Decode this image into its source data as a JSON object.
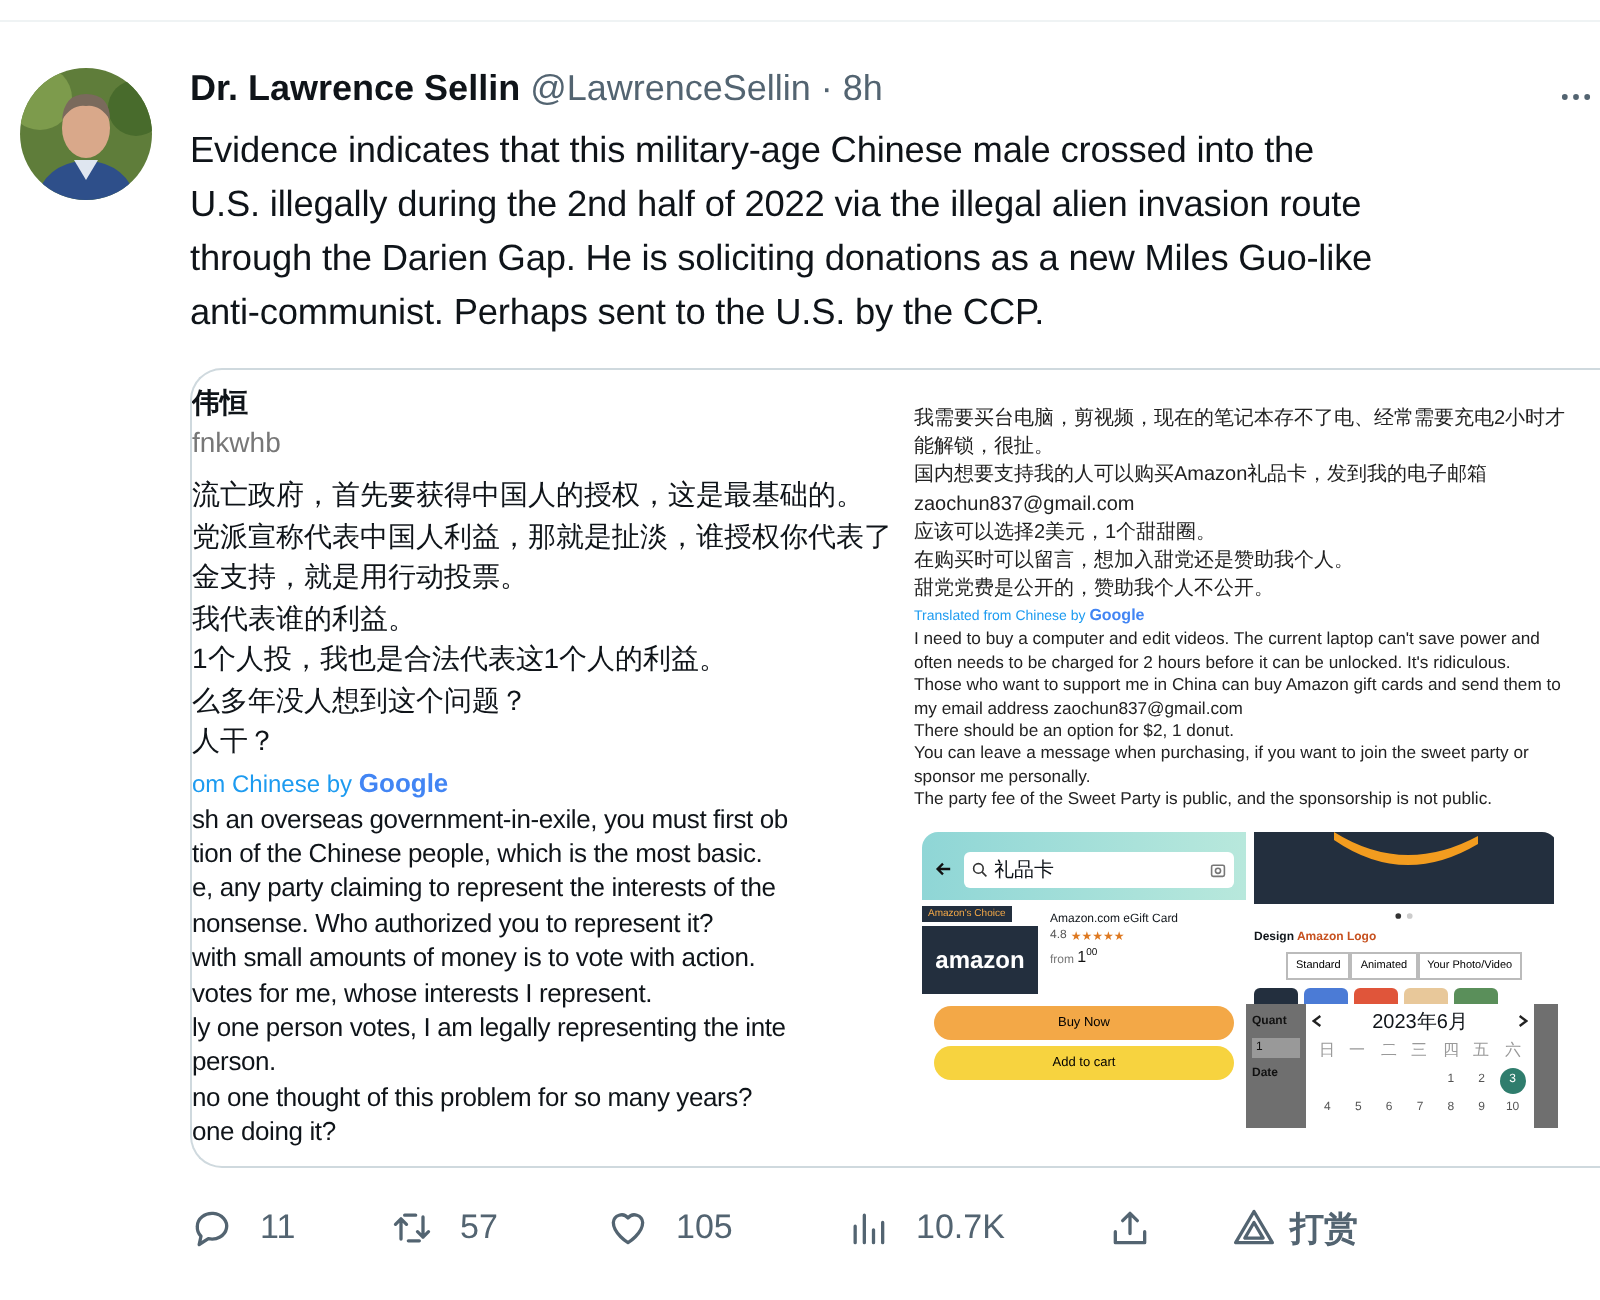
{
  "tweet": {
    "author": "Dr. Lawrence Sellin",
    "handle": "@LawrenceSellin",
    "separator": "·",
    "time": "8h",
    "text_lines": [
      "Evidence indicates that this military-age Chinese male crossed into the",
      "U.S. illegally during the 2nd half of 2022 via the illegal alien invasion route",
      "through the Darien Gap. He is soliciting donations as a new Miles Guo-like",
      "anti-communist. Perhaps sent to the U.S. by the CCP."
    ]
  },
  "left_image": {
    "name": "伟恒",
    "handle": "fnkwhb",
    "original_lines": [
      "流亡政府，首先要获得中国人的授权，这是最基础的。",
      "党派宣称代表中国人利益，那就是扯淡，谁授权你代表了",
      "金支持，就是用行动投票。",
      "我代表谁的利益。",
      "1个人投，我也是合法代表这1个人的利益。",
      "么多年没人想到这个问题？",
      "人干？"
    ],
    "translated_prefix": "om Chinese by",
    "translated_brand": "Google",
    "translation_lines": [
      "sh an overseas government-in-exile, you must first ob",
      "tion of the Chinese people, which is the most basic.",
      "e, any party claiming to represent the interests of the",
      "nonsense. Who authorized you to represent it?",
      "with small amounts of money is to vote with action.",
      "votes for me, whose interests I represent.",
      "ly one person votes, I am legally representing the inte",
      "person.",
      "no one thought of this problem for so many years?",
      "one doing it?"
    ]
  },
  "right_image": {
    "original_lines": [
      "我需要买台电脑，剪视频，现在的笔记本存不了电、经常需要充电2小时才能解锁，很扯。",
      "国内想要支持我的人可以购买Amazon礼品卡，发到我的电子邮箱 zaochun837@gmail.com",
      "应该可以选择2美元，1个甜甜圈。",
      "在购买时可以留言，想加入甜党还是赞助我个人。",
      "甜党党费是公开的，赞助我个人不公开。"
    ],
    "translated_prefix": "Translated from Chinese by",
    "translated_brand": "Google",
    "translation_lines": [
      "I need to buy a computer and edit videos. The current laptop can't save power and often needs to be charged for 2 hours before it can be unlocked. It's ridiculous.",
      "Those who want to support me in China can buy Amazon gift cards and send them to my email address zaochun837@gmail.com",
      "There should be an option for $2, 1 donut.",
      "You can leave a message when purchasing, if you want to join the sweet party or sponsor me personally.",
      "The party fee of the Sweet Party is public, and the sponsorship is not public."
    ],
    "store": {
      "search": "礼品卡",
      "badge": "Amazon's Choice",
      "logo": "amazon",
      "product": "Amazon.com eGift Card",
      "rating": "4.8",
      "stars": 5,
      "price_prefix": "from",
      "price_whole": "1",
      "price_fraction": "00",
      "buttons": [
        {
          "kind": "buy",
          "label": "Buy Now"
        },
        {
          "kind": "cart",
          "label": "Add to cart"
        }
      ],
      "design_label": "Design",
      "design_value": "Amazon Logo",
      "design_options": [
        "Standard",
        "Animated",
        "Your Photo/Video"
      ],
      "quantity_label": "Quant",
      "quantity": "1",
      "date_label": "Date",
      "calendar": {
        "month": "2023年6月",
        "weekdays": [
          "日",
          "一",
          "二",
          "三",
          "四",
          "五",
          "六"
        ],
        "weeks": [
          [
            {
              "kind": "blank"
            },
            {
              "kind": "blank"
            },
            {
              "kind": "blank"
            },
            {
              "kind": "blank"
            },
            {
              "day": "1",
              "selected": false
            },
            {
              "day": "2",
              "selected": false
            },
            {
              "day": "3",
              "selected": true
            }
          ],
          [
            {
              "day": "4",
              "selected": false
            },
            {
              "day": "5",
              "selected": false
            },
            {
              "day": "6",
              "selected": false
            },
            {
              "day": "7",
              "selected": false
            },
            {
              "day": "8",
              "selected": false
            },
            {
              "day": "9",
              "selected": false
            },
            {
              "day": "10",
              "selected": false
            }
          ]
        ]
      }
    }
  },
  "actions": [
    {
      "kind": "reply",
      "count": "11"
    },
    {
      "kind": "retweet",
      "count": "57"
    },
    {
      "kind": "like",
      "count": "105"
    },
    {
      "kind": "views",
      "count": "10.7K"
    },
    {
      "kind": "share"
    },
    {
      "kind": "tip",
      "count": "打赏"
    }
  ]
}
